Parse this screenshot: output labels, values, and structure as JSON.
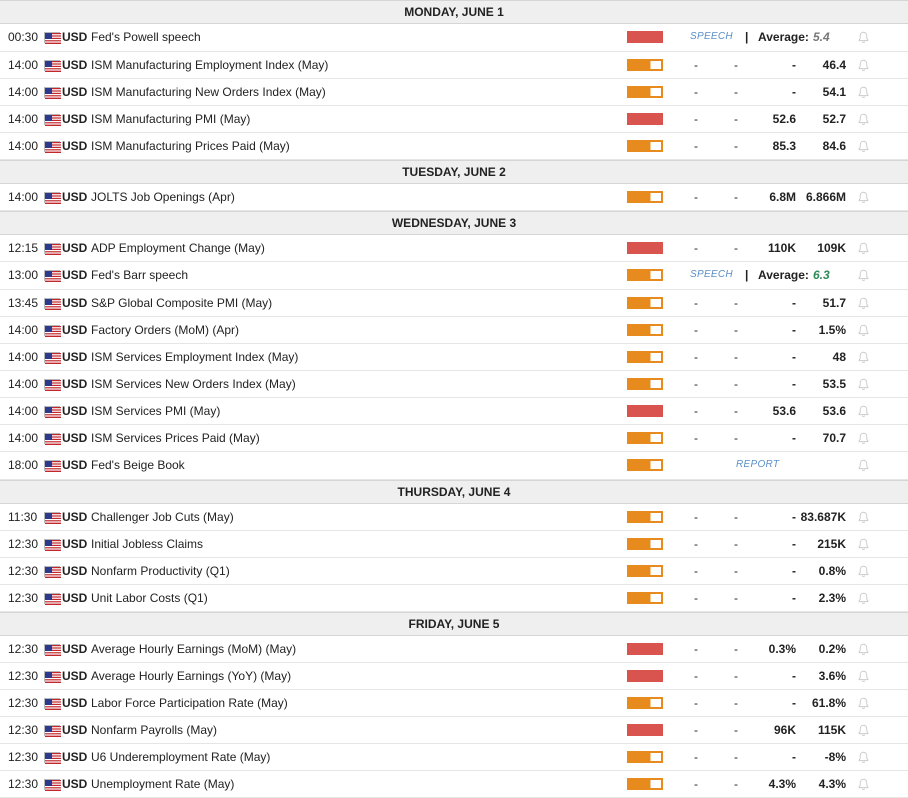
{
  "currency_code": "USD",
  "bell_glyph": "🔔",
  "days": [
    {
      "label": "MONDAY, JUNE 1",
      "events": [
        {
          "time": "00:30",
          "name": "Fed's Powell speech",
          "impact": "high",
          "tag": "SPEECH",
          "average_label": "Average:",
          "average": "5.4",
          "average_color": "grey"
        },
        {
          "time": "14:00",
          "name": "ISM Manufacturing Employment Index (May)",
          "impact": "medium",
          "actual": "-",
          "forecast": "-",
          "previous": "-",
          "consensus": "46.4"
        },
        {
          "time": "14:00",
          "name": "ISM Manufacturing New Orders Index (May)",
          "impact": "medium",
          "actual": "-",
          "forecast": "-",
          "previous": "-",
          "consensus": "54.1"
        },
        {
          "time": "14:00",
          "name": "ISM Manufacturing PMI (May)",
          "impact": "high",
          "actual": "-",
          "forecast": "-",
          "previous": "52.6",
          "consensus": "52.7"
        },
        {
          "time": "14:00",
          "name": "ISM Manufacturing Prices Paid (May)",
          "impact": "medium",
          "actual": "-",
          "forecast": "-",
          "previous": "85.3",
          "consensus": "84.6"
        }
      ]
    },
    {
      "label": "TUESDAY, JUNE 2",
      "events": [
        {
          "time": "14:00",
          "name": "JOLTS Job Openings (Apr)",
          "impact": "medium",
          "actual": "-",
          "forecast": "-",
          "previous": "6.8M",
          "consensus": "6.866M"
        }
      ]
    },
    {
      "label": "WEDNESDAY, JUNE 3",
      "events": [
        {
          "time": "12:15",
          "name": "ADP Employment Change (May)",
          "impact": "high",
          "actual": "-",
          "forecast": "-",
          "previous": "110K",
          "consensus": "109K"
        },
        {
          "time": "13:00",
          "name": "Fed's Barr speech",
          "impact": "medium",
          "tag": "SPEECH",
          "average_label": "Average:",
          "average": "6.3",
          "average_color": "green"
        },
        {
          "time": "13:45",
          "name": "S&P Global Composite PMI (May)",
          "impact": "medium",
          "actual": "-",
          "forecast": "-",
          "previous": "-",
          "consensus": "51.7"
        },
        {
          "time": "14:00",
          "name": "Factory Orders (MoM) (Apr)",
          "impact": "medium",
          "actual": "-",
          "forecast": "-",
          "previous": "-",
          "consensus": "1.5%"
        },
        {
          "time": "14:00",
          "name": "ISM Services Employment Index (May)",
          "impact": "medium",
          "actual": "-",
          "forecast": "-",
          "previous": "-",
          "consensus": "48"
        },
        {
          "time": "14:00",
          "name": "ISM Services New Orders Index (May)",
          "impact": "medium",
          "actual": "-",
          "forecast": "-",
          "previous": "-",
          "consensus": "53.5"
        },
        {
          "time": "14:00",
          "name": "ISM Services PMI (May)",
          "impact": "high",
          "actual": "-",
          "forecast": "-",
          "previous": "53.6",
          "consensus": "53.6"
        },
        {
          "time": "14:00",
          "name": "ISM Services Prices Paid (May)",
          "impact": "medium",
          "actual": "-",
          "forecast": "-",
          "previous": "-",
          "consensus": "70.7"
        },
        {
          "time": "18:00",
          "name": "Fed's Beige Book",
          "impact": "medium",
          "tag": "REPORT"
        }
      ]
    },
    {
      "label": "THURSDAY, JUNE 4",
      "events": [
        {
          "time": "11:30",
          "name": "Challenger Job Cuts (May)",
          "impact": "medium",
          "actual": "-",
          "forecast": "-",
          "previous": "-",
          "consensus": "83.687K"
        },
        {
          "time": "12:30",
          "name": "Initial Jobless Claims",
          "impact": "medium",
          "actual": "-",
          "forecast": "-",
          "previous": "-",
          "consensus": "215K"
        },
        {
          "time": "12:30",
          "name": "Nonfarm Productivity (Q1)",
          "impact": "medium",
          "actual": "-",
          "forecast": "-",
          "previous": "-",
          "consensus": "0.8%"
        },
        {
          "time": "12:30",
          "name": "Unit Labor Costs (Q1)",
          "impact": "medium",
          "actual": "-",
          "forecast": "-",
          "previous": "-",
          "consensus": "2.3%"
        }
      ]
    },
    {
      "label": "FRIDAY, JUNE 5",
      "events": [
        {
          "time": "12:30",
          "name": "Average Hourly Earnings (MoM) (May)",
          "impact": "high",
          "actual": "-",
          "forecast": "-",
          "previous": "0.3%",
          "consensus": "0.2%"
        },
        {
          "time": "12:30",
          "name": "Average Hourly Earnings (YoY) (May)",
          "impact": "high",
          "actual": "-",
          "forecast": "-",
          "previous": "-",
          "consensus": "3.6%"
        },
        {
          "time": "12:30",
          "name": "Labor Force Participation Rate (May)",
          "impact": "medium",
          "actual": "-",
          "forecast": "-",
          "previous": "-",
          "consensus": "61.8%"
        },
        {
          "time": "12:30",
          "name": "Nonfarm Payrolls (May)",
          "impact": "high",
          "actual": "-",
          "forecast": "-",
          "previous": "96K",
          "consensus": "115K"
        },
        {
          "time": "12:30",
          "name": "U6 Underemployment Rate (May)",
          "impact": "medium",
          "actual": "-",
          "forecast": "-",
          "previous": "-",
          "consensus": "-8%"
        },
        {
          "time": "12:30",
          "name": "Unemployment Rate (May)",
          "impact": "medium",
          "actual": "-",
          "forecast": "-",
          "previous": "4.3%",
          "consensus": "4.3%"
        }
      ]
    }
  ]
}
